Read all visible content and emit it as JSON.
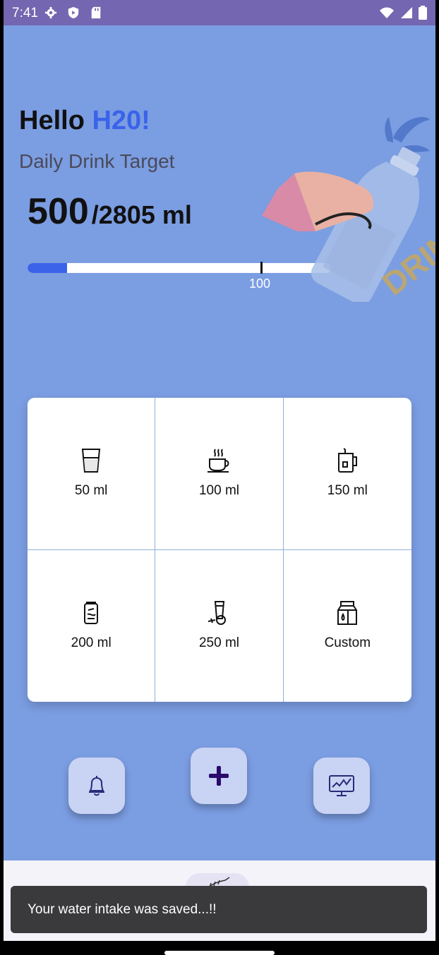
{
  "status": {
    "time": "7:41",
    "icons": [
      "gear-icon",
      "shield-icon",
      "sd-card-icon",
      "wifi-icon",
      "signal-icon",
      "battery-icon"
    ]
  },
  "greeting": {
    "prefix": "Hello",
    "name": "H20!"
  },
  "subtitle": "Daily Drink Target",
  "intake": {
    "current": "500",
    "target": "/2805 ml"
  },
  "progress": {
    "fraction": 0.13,
    "marker_label": "100"
  },
  "illustration": {
    "word": "DRINK"
  },
  "drinks": [
    {
      "label": "50 ml",
      "icon": "glass-icon"
    },
    {
      "label": "100 ml",
      "icon": "coffee-cup-icon"
    },
    {
      "label": "150 ml",
      "icon": "tea-mug-icon"
    },
    {
      "label": "200 ml",
      "icon": "soda-can-icon"
    },
    {
      "label": "250 ml",
      "icon": "juice-glass-icon"
    },
    {
      "label": "Custom",
      "icon": "milk-carton-icon"
    }
  ],
  "actions": [
    "bell-icon",
    "plus-icon",
    "chart-monitor-icon"
  ],
  "snackbar": "Your water intake was saved...!!",
  "colors": {
    "background": "#7b9de2",
    "accent": "#3a63ea",
    "statusbar": "#7466b0"
  }
}
